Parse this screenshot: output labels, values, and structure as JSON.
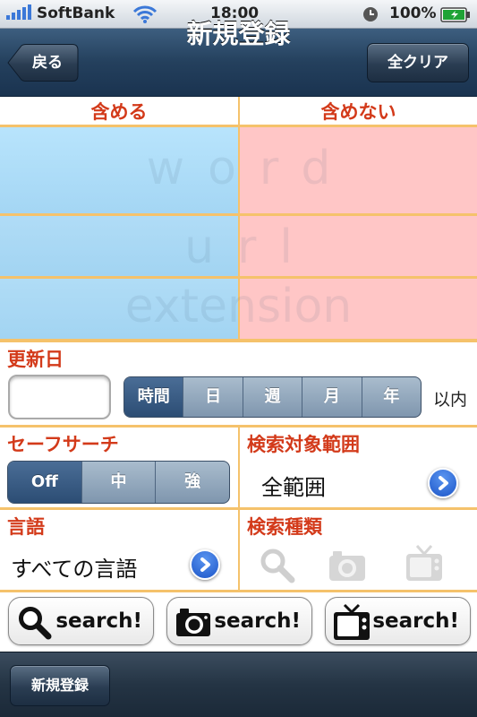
{
  "status": {
    "carrier": "SoftBank",
    "time": "18:00",
    "battery": "100%"
  },
  "nav": {
    "back_label": "戻る",
    "title": "新規登録",
    "clear_label": "全クリア"
  },
  "filter": {
    "include_header": "含める",
    "exclude_header": "含めない",
    "rows": [
      "word",
      "url",
      "extension"
    ]
  },
  "date": {
    "label": "更新日",
    "value": "",
    "units": [
      "時間",
      "日",
      "週",
      "月",
      "年"
    ],
    "selected": "時間",
    "suffix": "以内"
  },
  "safesearch": {
    "label": "セーフサーチ",
    "options": [
      "Off",
      "中",
      "強"
    ],
    "selected": "Off"
  },
  "scope": {
    "label": "検索対象範囲",
    "value": "全範囲"
  },
  "language": {
    "label": "言語",
    "value": "すべての言語"
  },
  "search_type": {
    "label": "検索種類",
    "icons": [
      "magnifier-icon",
      "camera-icon",
      "tv-icon"
    ]
  },
  "buttons": {
    "web": "search!",
    "image": "search!",
    "video": "search!"
  },
  "toolbar": {
    "register_label": "新規登録"
  },
  "colors": {
    "include_bg": "#b4e0fa",
    "exclude_bg": "#ffc8c8",
    "accent_red": "#d33a1a",
    "divider": "#f5c26b"
  }
}
